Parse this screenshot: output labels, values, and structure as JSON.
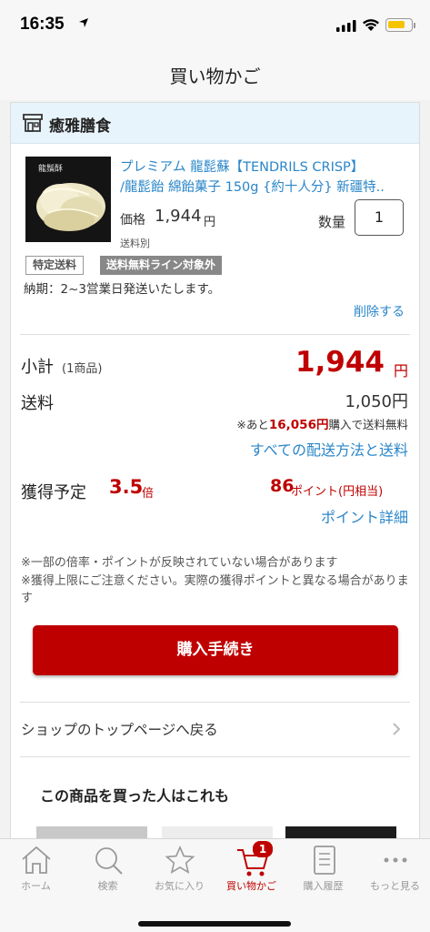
{
  "status_bar": {
    "time": "16:35"
  },
  "nav": {
    "title": "買い物かご"
  },
  "shop": {
    "name": "癒雅膳食"
  },
  "item": {
    "thumb_label": "龍鬚酥",
    "name_line1": "プレミアム 龍髭蘇【TENDRILS CRISP】",
    "name_line2": "/龍髭飴 綿飴菓子 150g {約十人分} 新疆特..",
    "price_label": "価格",
    "price": "1,944",
    "price_unit": "円",
    "shipping_note": "送料別",
    "qty_label": "数量",
    "qty": "1",
    "tag_1": "特定送料",
    "tag_2": "送料無料ライン対象外",
    "delivery": "納期：2~3営業日発送いたします。",
    "delete": "削除する"
  },
  "summary": {
    "subtotal_label": "小計",
    "subtotal_count": "(1商品)",
    "subtotal": "1,944",
    "subtotal_unit": "円",
    "shipping_label": "送料",
    "shipping": "1,050円",
    "free_prefix": "※あと",
    "free_amount": "16,056円",
    "free_suffix": "購入で送料無料",
    "all_shipping_link": "すべての配送方法と送料",
    "points_label": "獲得予定",
    "points_rate": "3.5",
    "points_rate_unit": "倍",
    "points": "86",
    "points_unit": "ポイント(円相当)",
    "points_detail": "ポイント詳細"
  },
  "notes": {
    "note1": "※一部の倍率・ポイントが反映されていない場合があります",
    "note2": "※獲得上限にご注意ください。実際の獲得ポイントと異なる場合があります"
  },
  "actions": {
    "purchase": "購入手続き",
    "shop_top": "ショップのトップページへ戻る"
  },
  "recommend": {
    "title": "この商品を買った人はこれも"
  },
  "tabs": [
    {
      "label": "ホーム",
      "icon": "home-icon"
    },
    {
      "label": "検索",
      "icon": "search-icon"
    },
    {
      "label": "お気に入り",
      "icon": "star-icon"
    },
    {
      "label": "買い物かご",
      "icon": "cart-icon",
      "badge": "1"
    },
    {
      "label": "購入履歴",
      "icon": "history-icon"
    },
    {
      "label": "もっと見る",
      "icon": "more-icon"
    }
  ],
  "colors": {
    "accent": "#bf0000",
    "link": "#2a86c9",
    "shop_header": "#e8f4fb"
  }
}
